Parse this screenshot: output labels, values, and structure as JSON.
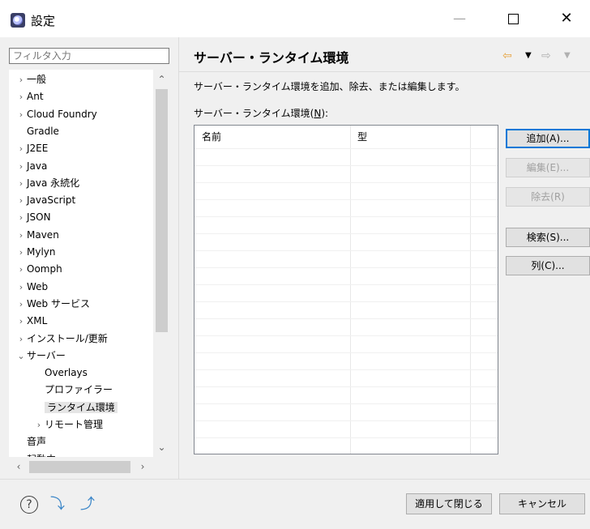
{
  "window": {
    "title": "設定"
  },
  "filter": {
    "placeholder": "フィルタ入力"
  },
  "tree": [
    {
      "label": "一般",
      "twisty": "›"
    },
    {
      "label": "Ant",
      "twisty": "›"
    },
    {
      "label": "Cloud Foundry",
      "twisty": "›"
    },
    {
      "label": "Gradle",
      "twisty": ""
    },
    {
      "label": "J2EE",
      "twisty": "›"
    },
    {
      "label": "Java",
      "twisty": "›"
    },
    {
      "label": "Java 永続化",
      "twisty": "›"
    },
    {
      "label": "JavaScript",
      "twisty": "›"
    },
    {
      "label": "JSON",
      "twisty": "›"
    },
    {
      "label": "Maven",
      "twisty": "›"
    },
    {
      "label": "Mylyn",
      "twisty": "›"
    },
    {
      "label": "Oomph",
      "twisty": "›"
    },
    {
      "label": "Web",
      "twisty": "›"
    },
    {
      "label": "Web サービス",
      "twisty": "›"
    },
    {
      "label": "XML",
      "twisty": "›"
    },
    {
      "label": "インストール/更新",
      "twisty": "›"
    },
    {
      "label": "サーバー",
      "twisty": "⌄"
    },
    {
      "label": "Overlays",
      "twisty": "",
      "child": true
    },
    {
      "label": "プロファイラー",
      "twisty": "",
      "child": true
    },
    {
      "label": "ランタイム環境",
      "twisty": "",
      "child": true,
      "selected": true
    },
    {
      "label": "リモート管理",
      "twisty": "›",
      "child": true
    },
    {
      "label": "音声",
      "twisty": ""
    },
    {
      "label": "起動中",
      "twisty": ""
    }
  ],
  "page": {
    "title": "サーバー・ランタイム環境",
    "description": "サーバー・ランタイム環境を追加、除去、または編集します。",
    "list_label_pre": "サーバー・ランタイム環境(",
    "list_label_mn": "N",
    "list_label_post": "):"
  },
  "table": {
    "columns": [
      "名前",
      "型"
    ]
  },
  "buttons": {
    "add": "追加(A)...",
    "edit": "編集(E)...",
    "remove": "除去(R)",
    "search": "検索(S)...",
    "columns": "列(C)..."
  },
  "footer": {
    "apply_close": "適用して閉じる",
    "cancel": "キャンセル"
  }
}
